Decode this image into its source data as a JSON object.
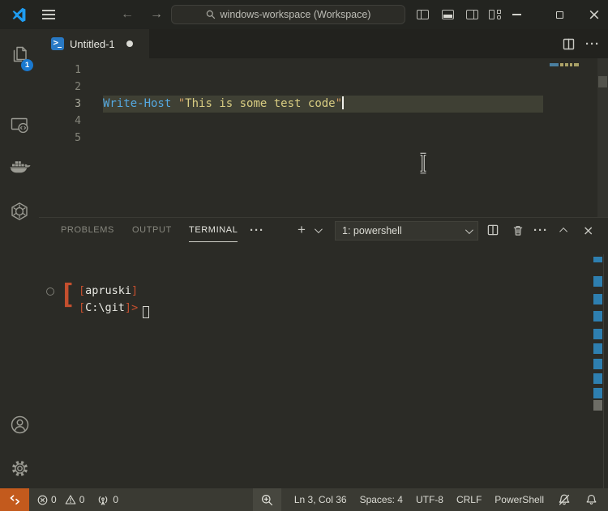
{
  "colors": {
    "accent_blue": "#1f9cf0",
    "badge_blue": "#1a79d0",
    "remote_orange": "#c35a1d",
    "terminal_red": "#c44f2e",
    "cmdlet_blue": "#55a8e0",
    "string_yellow": "#d8cc82",
    "quote_orange": "#cf9a62",
    "line_highlight": "#3f4034",
    "statusbar_bg": "#3a3a33",
    "editor_bg": "#2b2b26"
  },
  "title_bar": {
    "workspace": "windows-workspace (Workspace)",
    "icons": [
      "vscode-logo",
      "menu-hamburger",
      "arrow-back",
      "arrow-forward",
      "search-magnifier",
      "toggle-primary-sidebar",
      "toggle-panel",
      "toggle-secondary-sidebar",
      "customize-layout",
      "minimize",
      "restore",
      "close"
    ]
  },
  "activity_bar": {
    "explorer_badge": "1",
    "items": [
      {
        "name": "explorer",
        "icon": "files-icon"
      },
      {
        "name": "remote-explorer",
        "icon": "monitor-connect-icon"
      },
      {
        "name": "docker",
        "icon": "docker-whale-icon"
      },
      {
        "name": "kubernetes",
        "icon": "kubernetes-helm-icon"
      },
      {
        "name": "accounts",
        "icon": "person-circle-icon"
      },
      {
        "name": "manage",
        "icon": "gear-icon"
      }
    ]
  },
  "editor": {
    "tab": {
      "label": "Untitled-1",
      "modified": true,
      "icon": "powershell-file-icon"
    },
    "line_numbers": [
      "1",
      "2",
      "3",
      "4",
      "5"
    ],
    "active_line": "3",
    "code": {
      "cmdlet": "Write-Host",
      "space": " ",
      "open_quote": "\"",
      "body": "This is some test code",
      "close_quote": "\""
    }
  },
  "panel": {
    "tabs": [
      {
        "label": "PROBLEMS"
      },
      {
        "label": "OUTPUT"
      },
      {
        "label": "TERMINAL",
        "active": true
      }
    ],
    "more_label": "···",
    "new_terminal_label": "+",
    "terminal_select": "1: powershell",
    "action_icons": [
      "split-terminal",
      "kill-terminal-trash",
      "more-actions",
      "maximize-panel-chevron-up",
      "close-panel-x"
    ]
  },
  "terminal": {
    "big_bracket": "[",
    "line1": {
      "open": "[",
      "user": "apruski",
      "close": "]"
    },
    "line2": {
      "open": "[",
      "path": "C:\\git",
      "close": "]",
      "prompt": ">"
    }
  },
  "status_bar": {
    "errors": "0",
    "warnings": "0",
    "ports": "0",
    "cursor_position": "Ln 3, Col 36",
    "indentation": "Spaces: 4",
    "encoding": "UTF-8",
    "eol": "CRLF",
    "language": "PowerShell",
    "icons": [
      "remote-indicator",
      "error-circle",
      "warning-triangle",
      "broadcast-tower",
      "zoom-magnifier-plus",
      "bell-slash",
      "bell"
    ]
  }
}
